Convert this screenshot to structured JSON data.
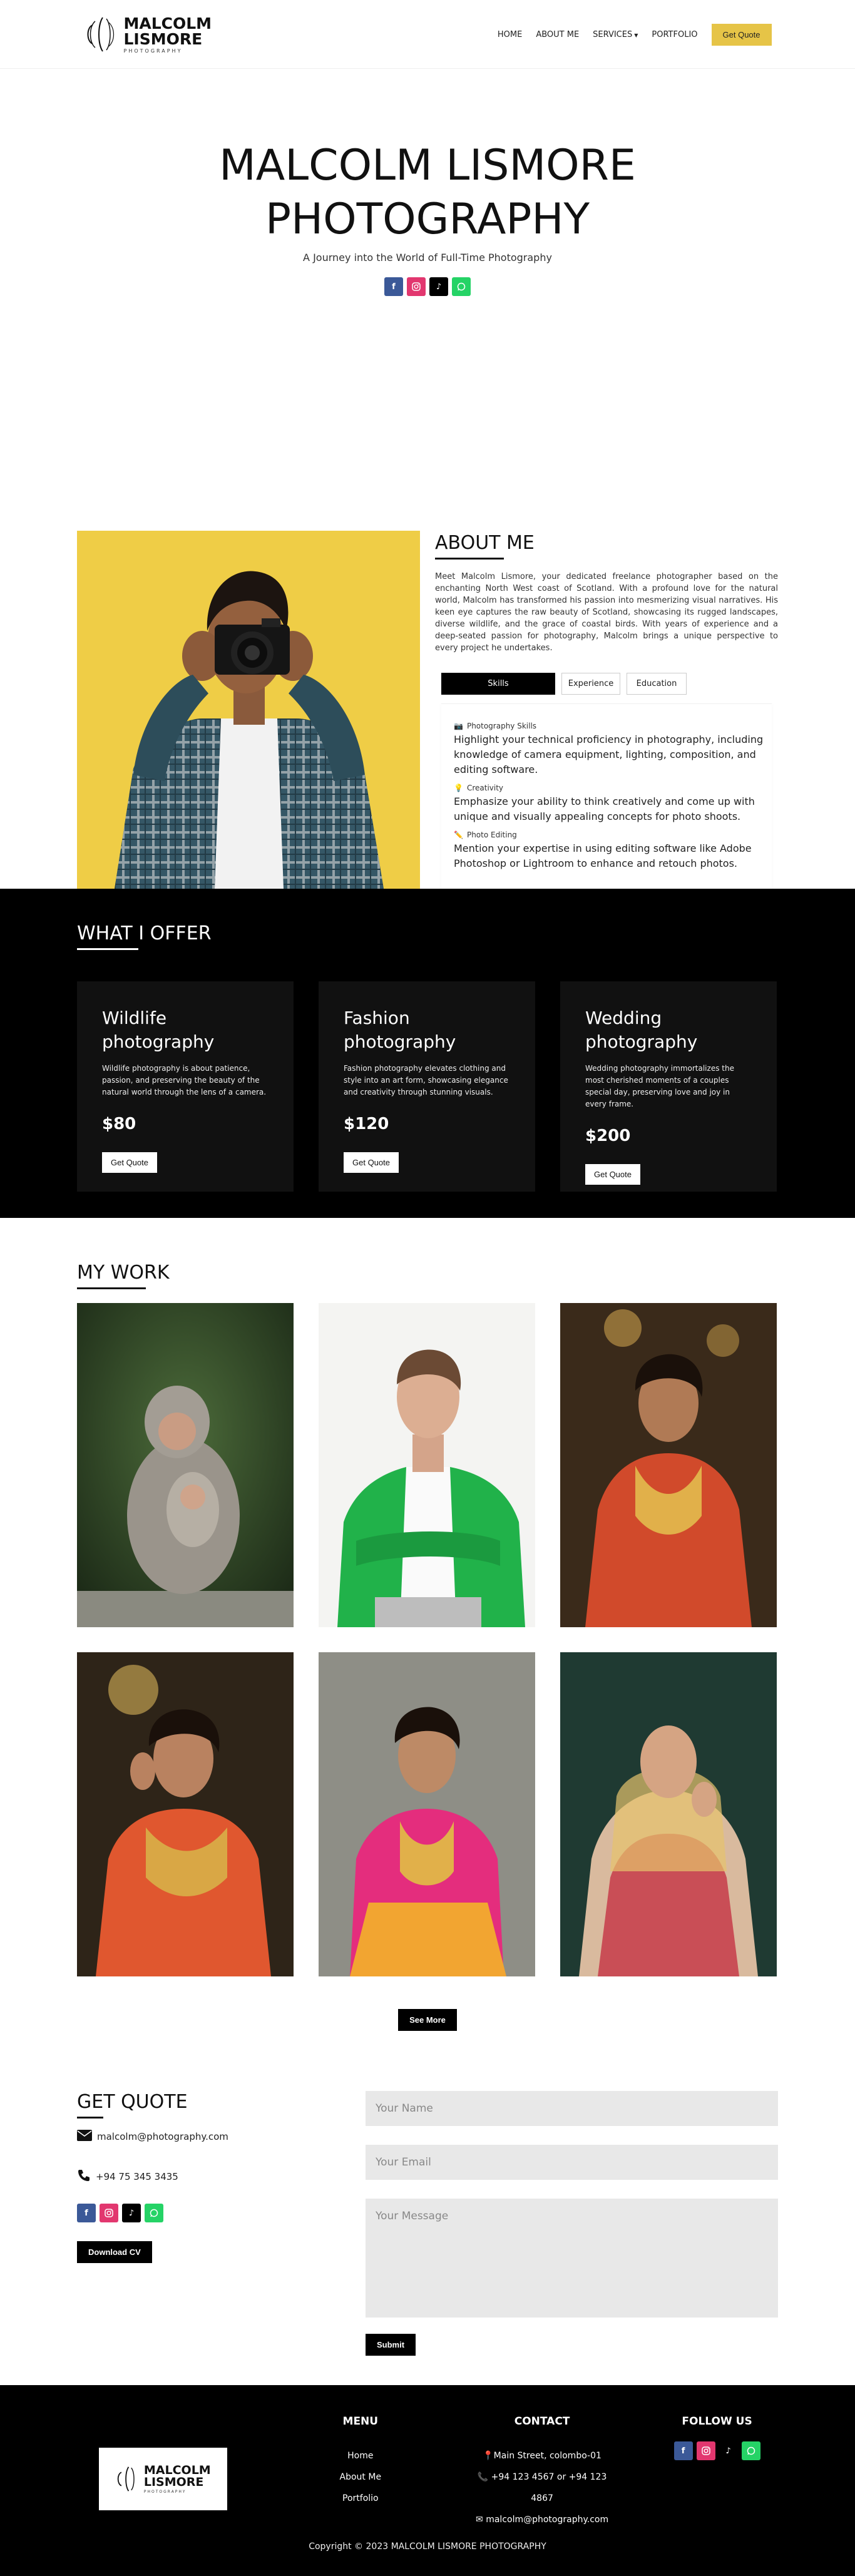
{
  "nav": {
    "logo_line1": "MALCOLM",
    "logo_line2": "LISMORE",
    "logo_line3": "PHOTOGRAPHY",
    "links": [
      "HOME",
      "ABOUT ME",
      "SERVICES",
      "PORTFOLIO"
    ],
    "cta": "Get Quote"
  },
  "hero": {
    "title_line1": "MALCOLM LISMORE",
    "title_line2": "PHOTOGRAPHY",
    "subtitle": "A Journey into the World of Full-Time Photography"
  },
  "social": {
    "icons": [
      "facebook-icon",
      "instagram-icon",
      "tiktok-icon",
      "whatsapp-icon"
    ],
    "colors": {
      "facebook": "#3b5998",
      "instagram": "#e2376f",
      "tiktok": "#000000",
      "whatsapp": "#25d366"
    }
  },
  "about": {
    "title": "ABOUT ME",
    "paragraph": "Meet Malcolm Lismore, your dedicated freelance photographer based on the enchanting North West coast of Scotland. With a profound love for the natural world, Malcolm has transformed his passion into mesmerizing visual narratives. His keen eye captures the raw beauty of Scotland, showcasing its rugged landscapes, diverse wildlife, and the grace of coastal birds. With years of experience and a deep-seated passion for photography, Malcolm brings a unique perspective to every project he undertakes.",
    "tabs": [
      "Skills",
      "Experience",
      "Education"
    ],
    "skills": [
      {
        "icon": "camera-icon",
        "name": "Photography Skills",
        "desc": "Highlight your technical proficiency in photography, including knowledge of camera equipment, lighting, composition, and editing software."
      },
      {
        "icon": "lightbulb-icon",
        "name": "Creativity",
        "desc": "Emphasize your ability to think creatively and come up with unique and visually appealing concepts for photo shoots."
      },
      {
        "icon": "pencil-icon",
        "name": "Photo Editing",
        "desc": "Mention your expertise in using editing software like Adobe Photoshop or Lightroom to enhance and retouch photos."
      }
    ]
  },
  "offer": {
    "title": "WHAT I OFFER",
    "cards": [
      {
        "title_line1": "Wildlife",
        "title_line2": "photography",
        "desc": "Wildlife photography is about patience, passion, and preserving the beauty of the natural world through the lens of a camera.",
        "price": "$80",
        "button": "Get Quote"
      },
      {
        "title_line1": "Fashion",
        "title_line2": "photography",
        "desc": "Fashion photography elevates clothing and style into an art form, showcasing elegance and creativity through stunning visuals.",
        "price": "$120",
        "button": "Get Quote"
      },
      {
        "title_line1": "Wedding",
        "title_line2": "photography",
        "desc": "Wedding photography immortalizes the most cherished moments of a couples special day, preserving love and joy in every frame.",
        "price": "$200",
        "button": "Get Quote"
      }
    ]
  },
  "work": {
    "title": "MY WORK",
    "see_more": "See More"
  },
  "quote": {
    "title": "GET QUOTE",
    "email": "malcolm@photography.com",
    "phone": "+94 75 345 3435",
    "download_cv": "Download CV",
    "name_placeholder": "Your Name",
    "email_placeholder": "Your Email",
    "message_placeholder": "Your Message",
    "submit": "Submit"
  },
  "footer": {
    "menu_title": "MENU",
    "menu_links": [
      "Home",
      "About Me",
      "Portfolio"
    ],
    "contact_title": "CONTACT",
    "address": "Main Street, colombo-01",
    "phones": "+94 123 4567 or +94 123 4867",
    "email": "malcolm@photography.com",
    "follow_title": "FOLLOW US",
    "copyright": "Copyright © 2023 MALCOLM LISMORE PHOTOGRAPHY"
  }
}
